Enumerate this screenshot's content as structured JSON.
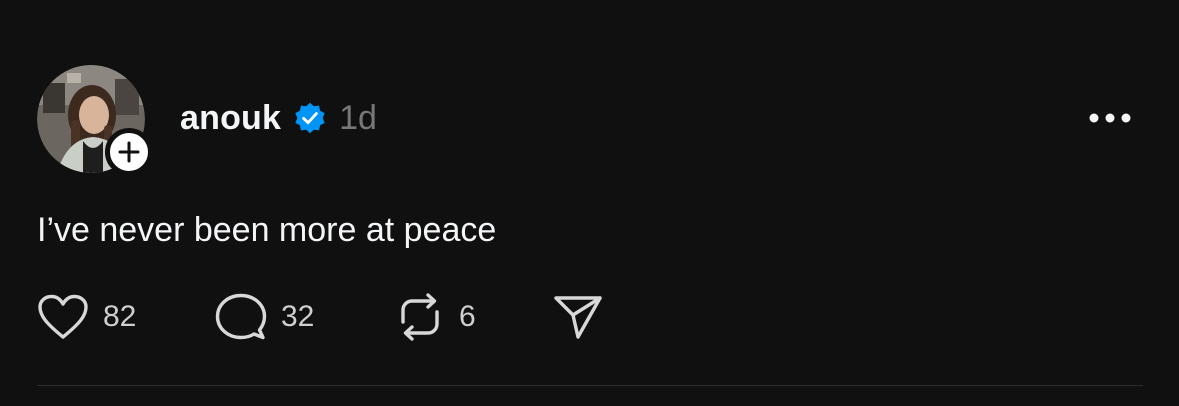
{
  "post": {
    "username": "anouk",
    "verified": true,
    "timestamp": "1d",
    "caption": "I’ve never been more at peace",
    "likes": "82",
    "replies": "32",
    "reposts": "6"
  },
  "icons": {
    "avatar": "profile-photo",
    "follow": "plus-icon",
    "verified": "verified-badge-icon",
    "more": "more-horizontal-icon",
    "like": "heart-icon",
    "reply": "comment-bubble-icon",
    "repost": "repost-icon",
    "share": "send-icon"
  },
  "colors": {
    "background": "#101010",
    "text": "#f3f5f7",
    "muted": "#777777",
    "verified": "#0095f6",
    "divider": "#2e2e2e"
  }
}
